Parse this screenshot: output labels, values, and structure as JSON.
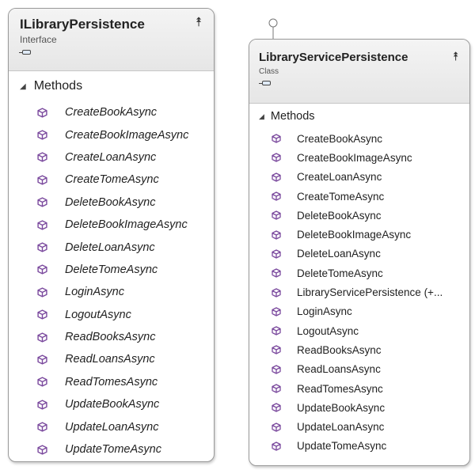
{
  "diagram": {
    "interface_card": {
      "title": "ILibraryPersistence",
      "stereotype": "Interface",
      "section_label": "Methods",
      "methods": [
        "CreateBookAsync",
        "CreateBookImageAsync",
        "CreateLoanAsync",
        "CreateTomeAsync",
        "DeleteBookAsync",
        "DeleteBookImageAsync",
        "DeleteLoanAsync",
        "DeleteTomeAsync",
        "LoginAsync",
        "LogoutAsync",
        "ReadBooksAsync",
        "ReadLoansAsync",
        "ReadTomesAsync",
        "UpdateBookAsync",
        "UpdateLoanAsync",
        "UpdateTomeAsync"
      ]
    },
    "class_card": {
      "title": "LibraryServicePersistence",
      "stereotype": "Class",
      "section_label": "Methods",
      "methods": [
        "CreateBookAsync",
        "CreateBookImageAsync",
        "CreateLoanAsync",
        "CreateTomeAsync",
        "DeleteBookAsync",
        "DeleteBookImageAsync",
        "DeleteLoanAsync",
        "DeleteTomeAsync",
        "LibraryServicePersistence (+...",
        "LoginAsync",
        "LogoutAsync",
        "ReadBooksAsync",
        "ReadLoansAsync",
        "ReadTomesAsync",
        "UpdateBookAsync",
        "UpdateLoanAsync",
        "UpdateTomeAsync"
      ]
    },
    "icons": {
      "collapse": "double-chevron-up-icon",
      "section_toggle": "triangle-expanded-icon",
      "member": "method-cube-icon",
      "kind": "type-kind-icon",
      "interface_marker": "interface-lollipop-icon"
    },
    "colors": {
      "method_icon": "#7b4a9e",
      "border": "#9a9a9a",
      "header_bg": "#eeeeee"
    }
  }
}
